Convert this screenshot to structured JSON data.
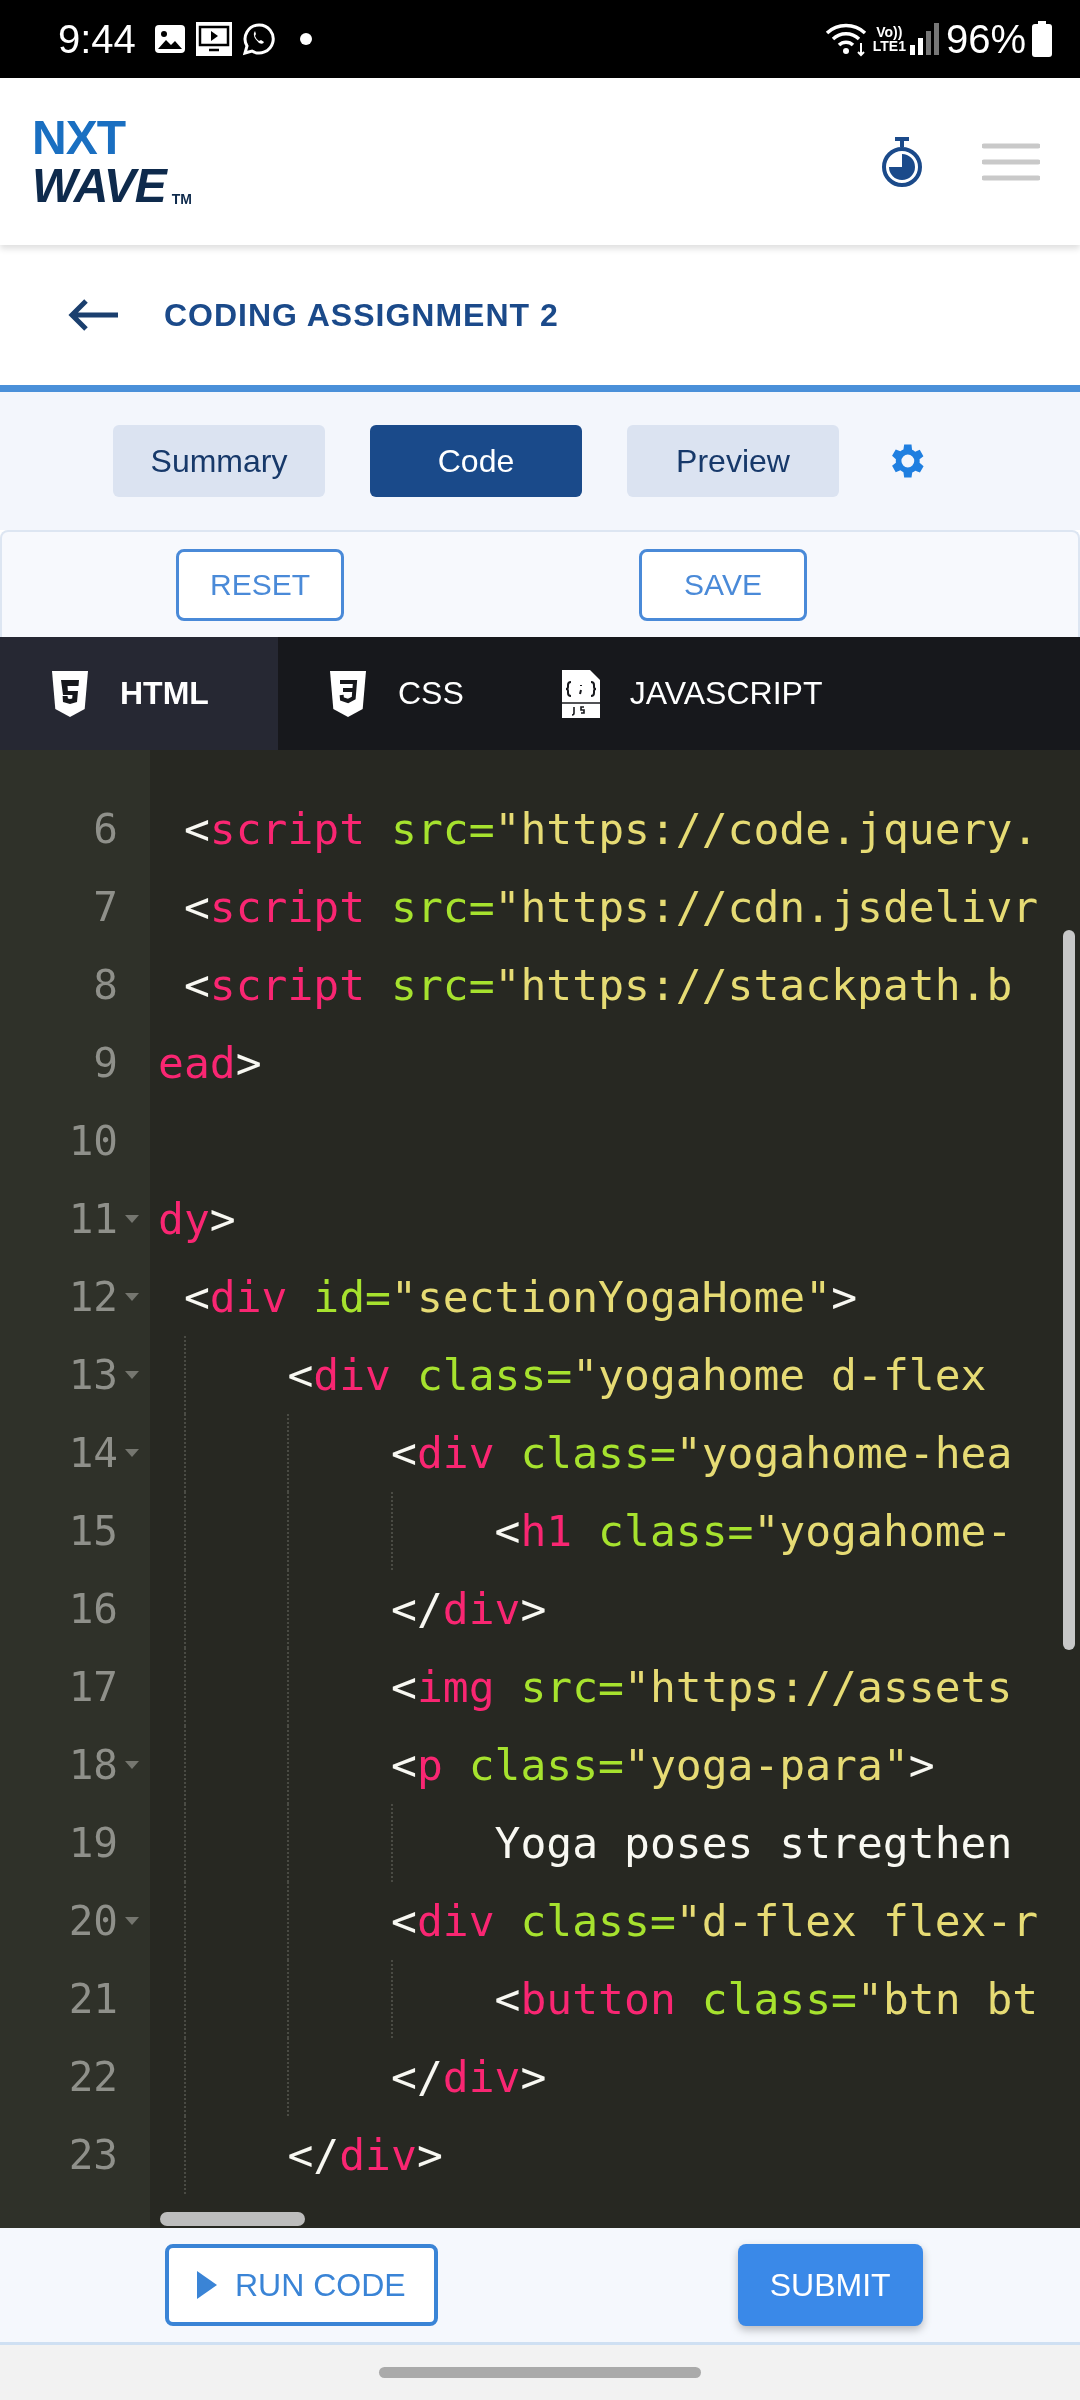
{
  "status_bar": {
    "time": "9:44",
    "network": "Vo))\nLTE1",
    "battery": "96%"
  },
  "header": {
    "logo": {
      "top": "NXT",
      "bottom": "WAVE",
      "mark": "TM"
    }
  },
  "title_bar": {
    "title": "CODING ASSIGNMENT 2"
  },
  "view_tabs": [
    {
      "label": "Summary",
      "selected": false
    },
    {
      "label": "Code",
      "selected": true
    },
    {
      "label": "Preview",
      "selected": false
    }
  ],
  "actions": [
    "RESET",
    "SAVE"
  ],
  "language_tabs": [
    {
      "label": "HTML",
      "kind": "html",
      "selected": true
    },
    {
      "label": "CSS",
      "kind": "css",
      "selected": false
    },
    {
      "label": "JAVASCRIPT",
      "kind": "js",
      "selected": false
    }
  ],
  "code_lines": [
    {
      "number": "6",
      "fold": false,
      "tokens": [
        {
          "kind": "punct",
          "text": " <"
        },
        {
          "kind": "tag",
          "text": "script"
        },
        {
          "kind": "attr",
          "text": " src="
        },
        {
          "kind": "string",
          "text": "\"https://code.jquery."
        }
      ]
    },
    {
      "number": "7",
      "fold": false,
      "tokens": [
        {
          "kind": "punct",
          "text": " <"
        },
        {
          "kind": "tag",
          "text": "script"
        },
        {
          "kind": "attr",
          "text": " src="
        },
        {
          "kind": "string",
          "text": "\"https://cdn.jsdelivr"
        }
      ]
    },
    {
      "number": "8",
      "fold": false,
      "tokens": [
        {
          "kind": "punct",
          "text": " <"
        },
        {
          "kind": "tag",
          "text": "script"
        },
        {
          "kind": "attr",
          "text": " src="
        },
        {
          "kind": "string",
          "text": "\"https://stackpath.b"
        }
      ]
    },
    {
      "number": "9",
      "fold": false,
      "tokens": [
        {
          "kind": "tag",
          "text": "ead"
        },
        {
          "kind": "punct",
          "text": ">"
        }
      ]
    },
    {
      "number": "10",
      "fold": false
    },
    {
      "number": "11",
      "fold": true,
      "tokens": [
        {
          "kind": "tag",
          "text": "dy"
        },
        {
          "kind": "punct",
          "text": ">"
        }
      ]
    },
    {
      "number": "12",
      "fold": true,
      "tokens": [
        {
          "kind": "punct",
          "text": " <"
        },
        {
          "kind": "tag",
          "text": "div"
        },
        {
          "kind": "attr",
          "text": " id="
        },
        {
          "kind": "string",
          "text": "\"sectionYogaHome\""
        },
        {
          "kind": "punct",
          "text": ">"
        }
      ]
    },
    {
      "number": "13",
      "fold": true,
      "tokens": [
        {
          "kind": "punct",
          "text": "     <"
        },
        {
          "kind": "tag",
          "text": "div"
        },
        {
          "kind": "attr",
          "text": " class="
        },
        {
          "kind": "string",
          "text": "\"yogahome d-flex"
        }
      ]
    },
    {
      "number": "14",
      "fold": true,
      "tokens": [
        {
          "kind": "punct",
          "text": "         <"
        },
        {
          "kind": "tag",
          "text": "div"
        },
        {
          "kind": "attr",
          "text": " class="
        },
        {
          "kind": "string",
          "text": "\"yogahome-hea"
        }
      ]
    },
    {
      "number": "15",
      "fold": false,
      "tokens": [
        {
          "kind": "punct",
          "text": "             <"
        },
        {
          "kind": "tag",
          "text": "h1"
        },
        {
          "kind": "attr",
          "text": " class="
        },
        {
          "kind": "string",
          "text": "\"yogahome-"
        }
      ]
    },
    {
      "number": "16",
      "fold": false,
      "tokens": [
        {
          "kind": "punct",
          "text": "         </"
        },
        {
          "kind": "tag",
          "text": "div"
        },
        {
          "kind": "punct",
          "text": ">"
        }
      ]
    },
    {
      "number": "17",
      "fold": false,
      "tokens": [
        {
          "kind": "punct",
          "text": "         <"
        },
        {
          "kind": "tag",
          "text": "img"
        },
        {
          "kind": "attr",
          "text": " src="
        },
        {
          "kind": "string",
          "text": "\"https://assets"
        }
      ]
    },
    {
      "number": "18",
      "fold": true,
      "tokens": [
        {
          "kind": "punct",
          "text": "         <"
        },
        {
          "kind": "tag",
          "text": "p"
        },
        {
          "kind": "attr",
          "text": " class="
        },
        {
          "kind": "string",
          "text": "\"yoga-para\""
        },
        {
          "kind": "punct",
          "text": ">"
        }
      ]
    },
    {
      "number": "19",
      "fold": false,
      "tokens": [
        {
          "kind": "text",
          "text": "             Yoga poses stregthen"
        }
      ]
    },
    {
      "number": "20",
      "fold": true,
      "tokens": [
        {
          "kind": "punct",
          "text": "         <"
        },
        {
          "kind": "tag",
          "text": "div"
        },
        {
          "kind": "attr",
          "text": " class="
        },
        {
          "kind": "string",
          "text": "\"d-flex flex-r"
        }
      ]
    },
    {
      "number": "21",
      "fold": false,
      "tokens": [
        {
          "kind": "punct",
          "text": "             <"
        },
        {
          "kind": "tag",
          "text": "button"
        },
        {
          "kind": "attr",
          "text": " class="
        },
        {
          "kind": "string",
          "text": "\"btn bt"
        }
      ]
    },
    {
      "number": "22",
      "fold": false,
      "tokens": [
        {
          "kind": "punct",
          "text": "         </"
        },
        {
          "kind": "tag",
          "text": "div"
        },
        {
          "kind": "punct",
          "text": ">"
        }
      ]
    },
    {
      "number": "23",
      "fold": false,
      "tokens": [
        {
          "kind": "punct",
          "text": "     </"
        },
        {
          "kind": "tag",
          "text": "div"
        },
        {
          "kind": "punct",
          "text": ">"
        }
      ]
    }
  ],
  "footer_buttons": [
    {
      "label": "RUN CODE",
      "kind": "outline"
    },
    {
      "label": "SUBMIT",
      "kind": "primary"
    }
  ]
}
